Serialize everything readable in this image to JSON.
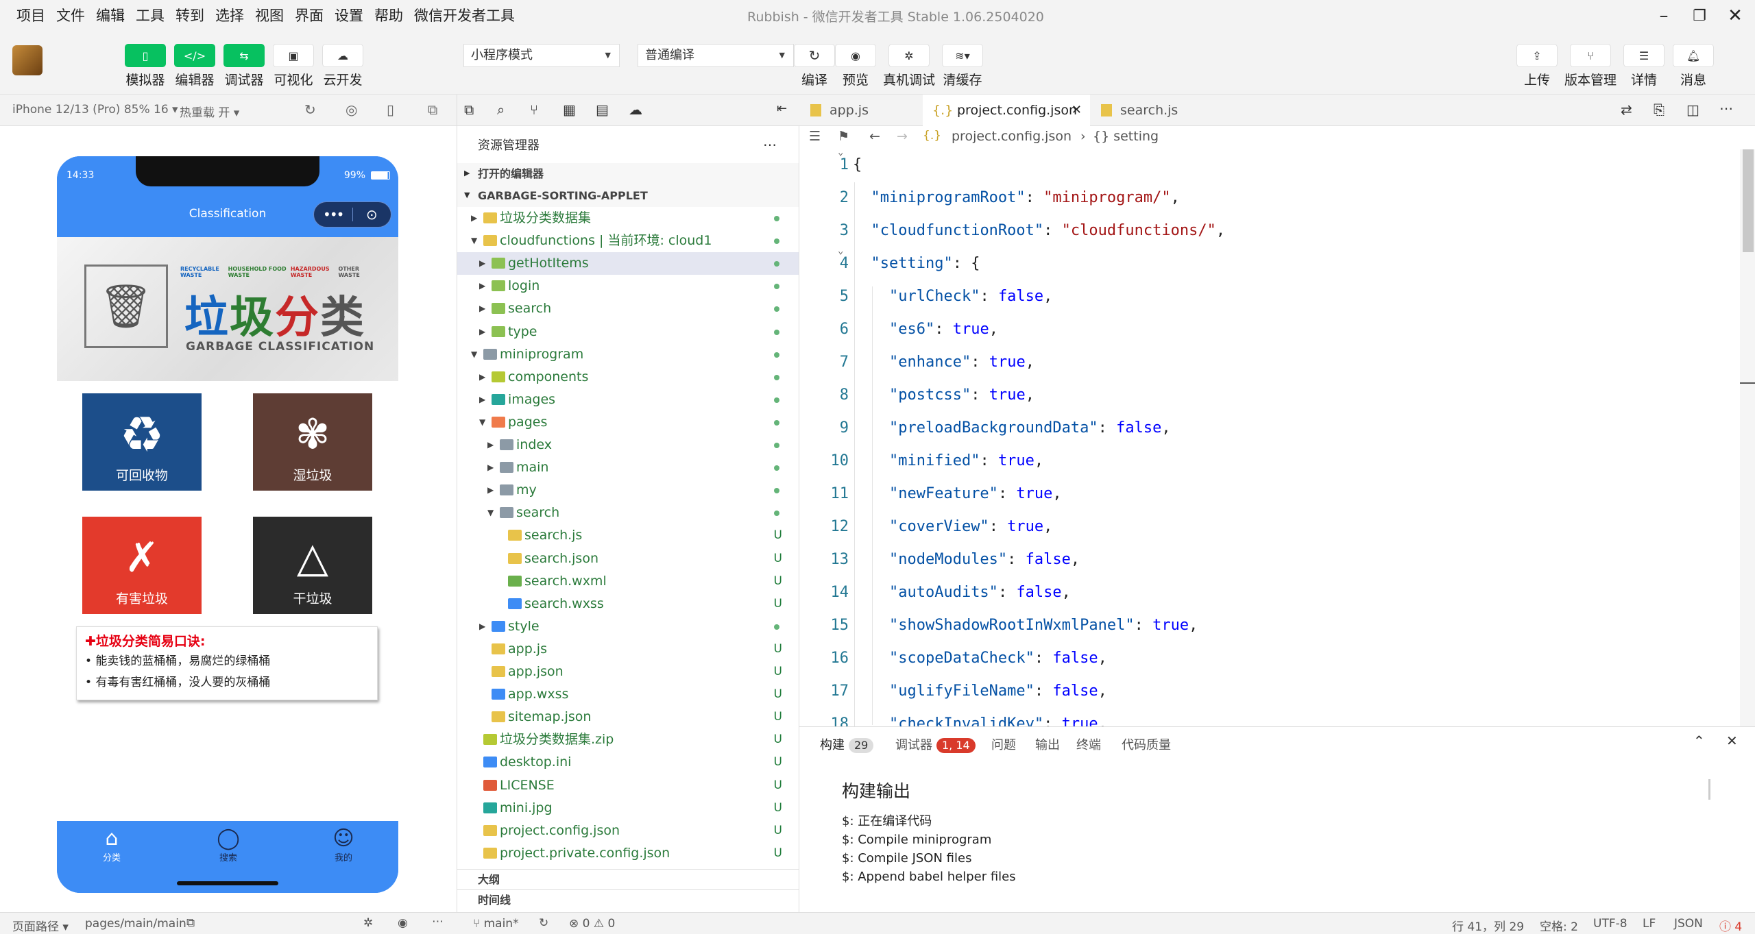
{
  "menu": [
    "项目",
    "文件",
    "编辑",
    "工具",
    "转到",
    "选择",
    "视图",
    "界面",
    "设置",
    "帮助",
    "微信开发者工具"
  ],
  "window_title": "Rubbish - 微信开发者工具 Stable 1.06.2504020",
  "toolbar": {
    "simulator": "模拟器",
    "editor": "编辑器",
    "debugger": "调试器",
    "visual": "可视化",
    "cloud": "云开发",
    "mode": "小程序模式",
    "compile_mode": "普通编译",
    "compile": "编译",
    "preview": "预览",
    "realdebug": "真机调试",
    "clearcache": "清缓存",
    "upload": "上传",
    "version": "版本管理",
    "details": "详情",
    "messages": "消息"
  },
  "sim": {
    "device": "iPhone 12/13 (Pro) 85% 16",
    "hotreload": "热重载 开",
    "time": "14:33",
    "battery": "99%",
    "nav_title": "Classification",
    "banner_title": "垃圾分类",
    "banner_sub": "GARBAGE CLASSIFICATION",
    "banner_tags": [
      "RECYCLABLE WASTE",
      "HOUSEHOLD FOOD WASTE",
      "HAZARDOUS WASTE",
      "OTHER WASTE"
    ],
    "categories": [
      "可回收物",
      "湿垃圾",
      "有害垃圾",
      "干垃圾"
    ],
    "tips_title": "垃圾分类简易口诀:",
    "tips": [
      "• 能卖钱的蓝桶桶，易腐烂的绿桶桶",
      "• 有毒有害红桶桶，没人要的灰桶桶"
    ],
    "tabs": [
      "分类",
      "搜索",
      "我的"
    ]
  },
  "explorer": {
    "title": "资源管理器",
    "open_editors": "打开的编辑器",
    "project": "GARBAGE-SORTING-APPLET",
    "outline": "大纲",
    "timeline": "时间线",
    "rows": [
      {
        "name": "垃圾分类数据集",
        "lvl": 1,
        "arrow": "▶",
        "color": "#e8c34a",
        "st": "dot"
      },
      {
        "name": "cloudfunctions | 当前环境: cloud1",
        "lvl": 1,
        "arrow": "▼",
        "color": "#e8c34a",
        "st": "dot"
      },
      {
        "name": "getHotItems",
        "lvl": 2,
        "arrow": "▶",
        "color": "#8cc152",
        "st": "dot",
        "sel": true
      },
      {
        "name": "login",
        "lvl": 2,
        "arrow": "▶",
        "color": "#8cc152",
        "st": "dot"
      },
      {
        "name": "search",
        "lvl": 2,
        "arrow": "▶",
        "color": "#8cc152",
        "st": "dot"
      },
      {
        "name": "type",
        "lvl": 2,
        "arrow": "▶",
        "color": "#8cc152",
        "st": "dot"
      },
      {
        "name": "miniprogram",
        "lvl": 1,
        "arrow": "▼",
        "color": "#8c9aa6",
        "st": "dot"
      },
      {
        "name": "components",
        "lvl": 2,
        "arrow": "▶",
        "color": "#b5c934",
        "st": "dot"
      },
      {
        "name": "images",
        "lvl": 2,
        "arrow": "▶",
        "color": "#26a69a",
        "st": "dot"
      },
      {
        "name": "pages",
        "lvl": 2,
        "arrow": "▼",
        "color": "#f07b4b",
        "st": "dot"
      },
      {
        "name": "index",
        "lvl": 3,
        "arrow": "▶",
        "color": "#8c9aa6",
        "st": "dot"
      },
      {
        "name": "main",
        "lvl": 3,
        "arrow": "▶",
        "color": "#8c9aa6",
        "st": "dot"
      },
      {
        "name": "my",
        "lvl": 3,
        "arrow": "▶",
        "color": "#8c9aa6",
        "st": "dot"
      },
      {
        "name": "search",
        "lvl": 3,
        "arrow": "▼",
        "color": "#8c9aa6",
        "st": "dot"
      },
      {
        "name": "search.js",
        "lvl": 4,
        "arrow": "",
        "color": "#e8c34a",
        "st": "U"
      },
      {
        "name": "search.json",
        "lvl": 4,
        "arrow": "",
        "color": "#e8c34a",
        "st": "U"
      },
      {
        "name": "search.wxml",
        "lvl": 4,
        "arrow": "",
        "color": "#6ab04c",
        "st": "U"
      },
      {
        "name": "search.wxss",
        "lvl": 4,
        "arrow": "",
        "color": "#3d8cf5",
        "st": "U"
      },
      {
        "name": "style",
        "lvl": 2,
        "arrow": "▶",
        "color": "#3d8cf5",
        "st": "dot"
      },
      {
        "name": "app.js",
        "lvl": 2,
        "arrow": "",
        "color": "#e8c34a",
        "st": "U"
      },
      {
        "name": "app.json",
        "lvl": 2,
        "arrow": "",
        "color": "#e8c34a",
        "st": "U"
      },
      {
        "name": "app.wxss",
        "lvl": 2,
        "arrow": "",
        "color": "#3d8cf5",
        "st": "U"
      },
      {
        "name": "sitemap.json",
        "lvl": 2,
        "arrow": "",
        "color": "#e8c34a",
        "st": "U"
      },
      {
        "name": "垃圾分类数据集.zip",
        "lvl": 1,
        "arrow": "",
        "color": "#b5c934",
        "st": "U"
      },
      {
        "name": "desktop.ini",
        "lvl": 1,
        "arrow": "",
        "color": "#3d8cf5",
        "st": "U"
      },
      {
        "name": "LICENSE",
        "lvl": 1,
        "arrow": "",
        "color": "#e05a3a",
        "st": "U"
      },
      {
        "name": "mini.jpg",
        "lvl": 1,
        "arrow": "",
        "color": "#26a69a",
        "st": "U"
      },
      {
        "name": "project.config.json",
        "lvl": 1,
        "arrow": "",
        "color": "#e8c34a",
        "st": "U"
      },
      {
        "name": "project.private.config.json",
        "lvl": 1,
        "arrow": "",
        "color": "#e8c34a",
        "st": "U"
      }
    ]
  },
  "editor": {
    "tabs": [
      "app.js",
      "project.config.json",
      "search.js"
    ],
    "crumb_file": "project.config.json",
    "crumb_sym": "{} setting",
    "lines": [
      [
        [
          "{",
          "pun"
        ]
      ],
      [
        [
          "  ",
          ""
        ],
        [
          "\"miniprogramRoot\"",
          "key"
        ],
        [
          ": ",
          "pun"
        ],
        [
          "\"miniprogram/\"",
          "s"
        ],
        [
          ",",
          "pun"
        ]
      ],
      [
        [
          "  ",
          ""
        ],
        [
          "\"cloudfunctionRoot\"",
          "key"
        ],
        [
          ": ",
          "pun"
        ],
        [
          "\"cloudfunctions/\"",
          "s"
        ],
        [
          ",",
          "pun"
        ]
      ],
      [
        [
          "  ",
          ""
        ],
        [
          "\"setting\"",
          "key"
        ],
        [
          ": {",
          "pun"
        ]
      ],
      [
        [
          "    ",
          ""
        ],
        [
          "\"urlCheck\"",
          "key"
        ],
        [
          ": ",
          "pun"
        ],
        [
          "false",
          "v"
        ],
        [
          ",",
          "pun"
        ]
      ],
      [
        [
          "    ",
          ""
        ],
        [
          "\"es6\"",
          "key"
        ],
        [
          ": ",
          "pun"
        ],
        [
          "true",
          "v"
        ],
        [
          ",",
          "pun"
        ]
      ],
      [
        [
          "    ",
          ""
        ],
        [
          "\"enhance\"",
          "key"
        ],
        [
          ": ",
          "pun"
        ],
        [
          "true",
          "v"
        ],
        [
          ",",
          "pun"
        ]
      ],
      [
        [
          "    ",
          ""
        ],
        [
          "\"postcss\"",
          "key"
        ],
        [
          ": ",
          "pun"
        ],
        [
          "true",
          "v"
        ],
        [
          ",",
          "pun"
        ]
      ],
      [
        [
          "    ",
          ""
        ],
        [
          "\"preloadBackgroundData\"",
          "key"
        ],
        [
          ": ",
          "pun"
        ],
        [
          "false",
          "v"
        ],
        [
          ",",
          "pun"
        ]
      ],
      [
        [
          "    ",
          ""
        ],
        [
          "\"minified\"",
          "key"
        ],
        [
          ": ",
          "pun"
        ],
        [
          "true",
          "v"
        ],
        [
          ",",
          "pun"
        ]
      ],
      [
        [
          "    ",
          ""
        ],
        [
          "\"newFeature\"",
          "key"
        ],
        [
          ": ",
          "pun"
        ],
        [
          "true",
          "v"
        ],
        [
          ",",
          "pun"
        ]
      ],
      [
        [
          "    ",
          ""
        ],
        [
          "\"coverView\"",
          "key"
        ],
        [
          ": ",
          "pun"
        ],
        [
          "true",
          "v"
        ],
        [
          ",",
          "pun"
        ]
      ],
      [
        [
          "    ",
          ""
        ],
        [
          "\"nodeModules\"",
          "key"
        ],
        [
          ": ",
          "pun"
        ],
        [
          "false",
          "v"
        ],
        [
          ",",
          "pun"
        ]
      ],
      [
        [
          "    ",
          ""
        ],
        [
          "\"autoAudits\"",
          "key"
        ],
        [
          ": ",
          "pun"
        ],
        [
          "false",
          "v"
        ],
        [
          ",",
          "pun"
        ]
      ],
      [
        [
          "    ",
          ""
        ],
        [
          "\"showShadowRootInWxmlPanel\"",
          "key"
        ],
        [
          ": ",
          "pun"
        ],
        [
          "true",
          "v"
        ],
        [
          ",",
          "pun"
        ]
      ],
      [
        [
          "    ",
          ""
        ],
        [
          "\"scopeDataCheck\"",
          "key"
        ],
        [
          ": ",
          "pun"
        ],
        [
          "false",
          "v"
        ],
        [
          ",",
          "pun"
        ]
      ],
      [
        [
          "    ",
          ""
        ],
        [
          "\"uglifyFileName\"",
          "key"
        ],
        [
          ": ",
          "pun"
        ],
        [
          "false",
          "v"
        ],
        [
          ",",
          "pun"
        ]
      ],
      [
        [
          "    ",
          ""
        ],
        [
          "\"checkInvalidKey\"",
          "key"
        ],
        [
          ": ",
          "pun"
        ],
        [
          "true",
          "v"
        ],
        [
          ",",
          "pun"
        ]
      ]
    ]
  },
  "panel": {
    "tabs": [
      "构建",
      "调试器",
      "问题",
      "输出",
      "终端",
      "代码质量"
    ],
    "build_count": "29",
    "debug_count": "1, 14",
    "heading": "构建输出",
    "log": [
      "$: 正在编译代码",
      "$: Compile miniprogram",
      "$: Compile JSON files",
      "$: Append babel helper files"
    ]
  },
  "status": {
    "page_path_label": "页面路径",
    "page_path": "pages/main/main",
    "branch": "main*",
    "errors": "0",
    "warnings": "0",
    "cursor": "行 41，列 29",
    "spaces": "空格: 2",
    "encoding": "UTF-8",
    "eol": "LF",
    "lang": "JSON",
    "alerts": "4"
  }
}
